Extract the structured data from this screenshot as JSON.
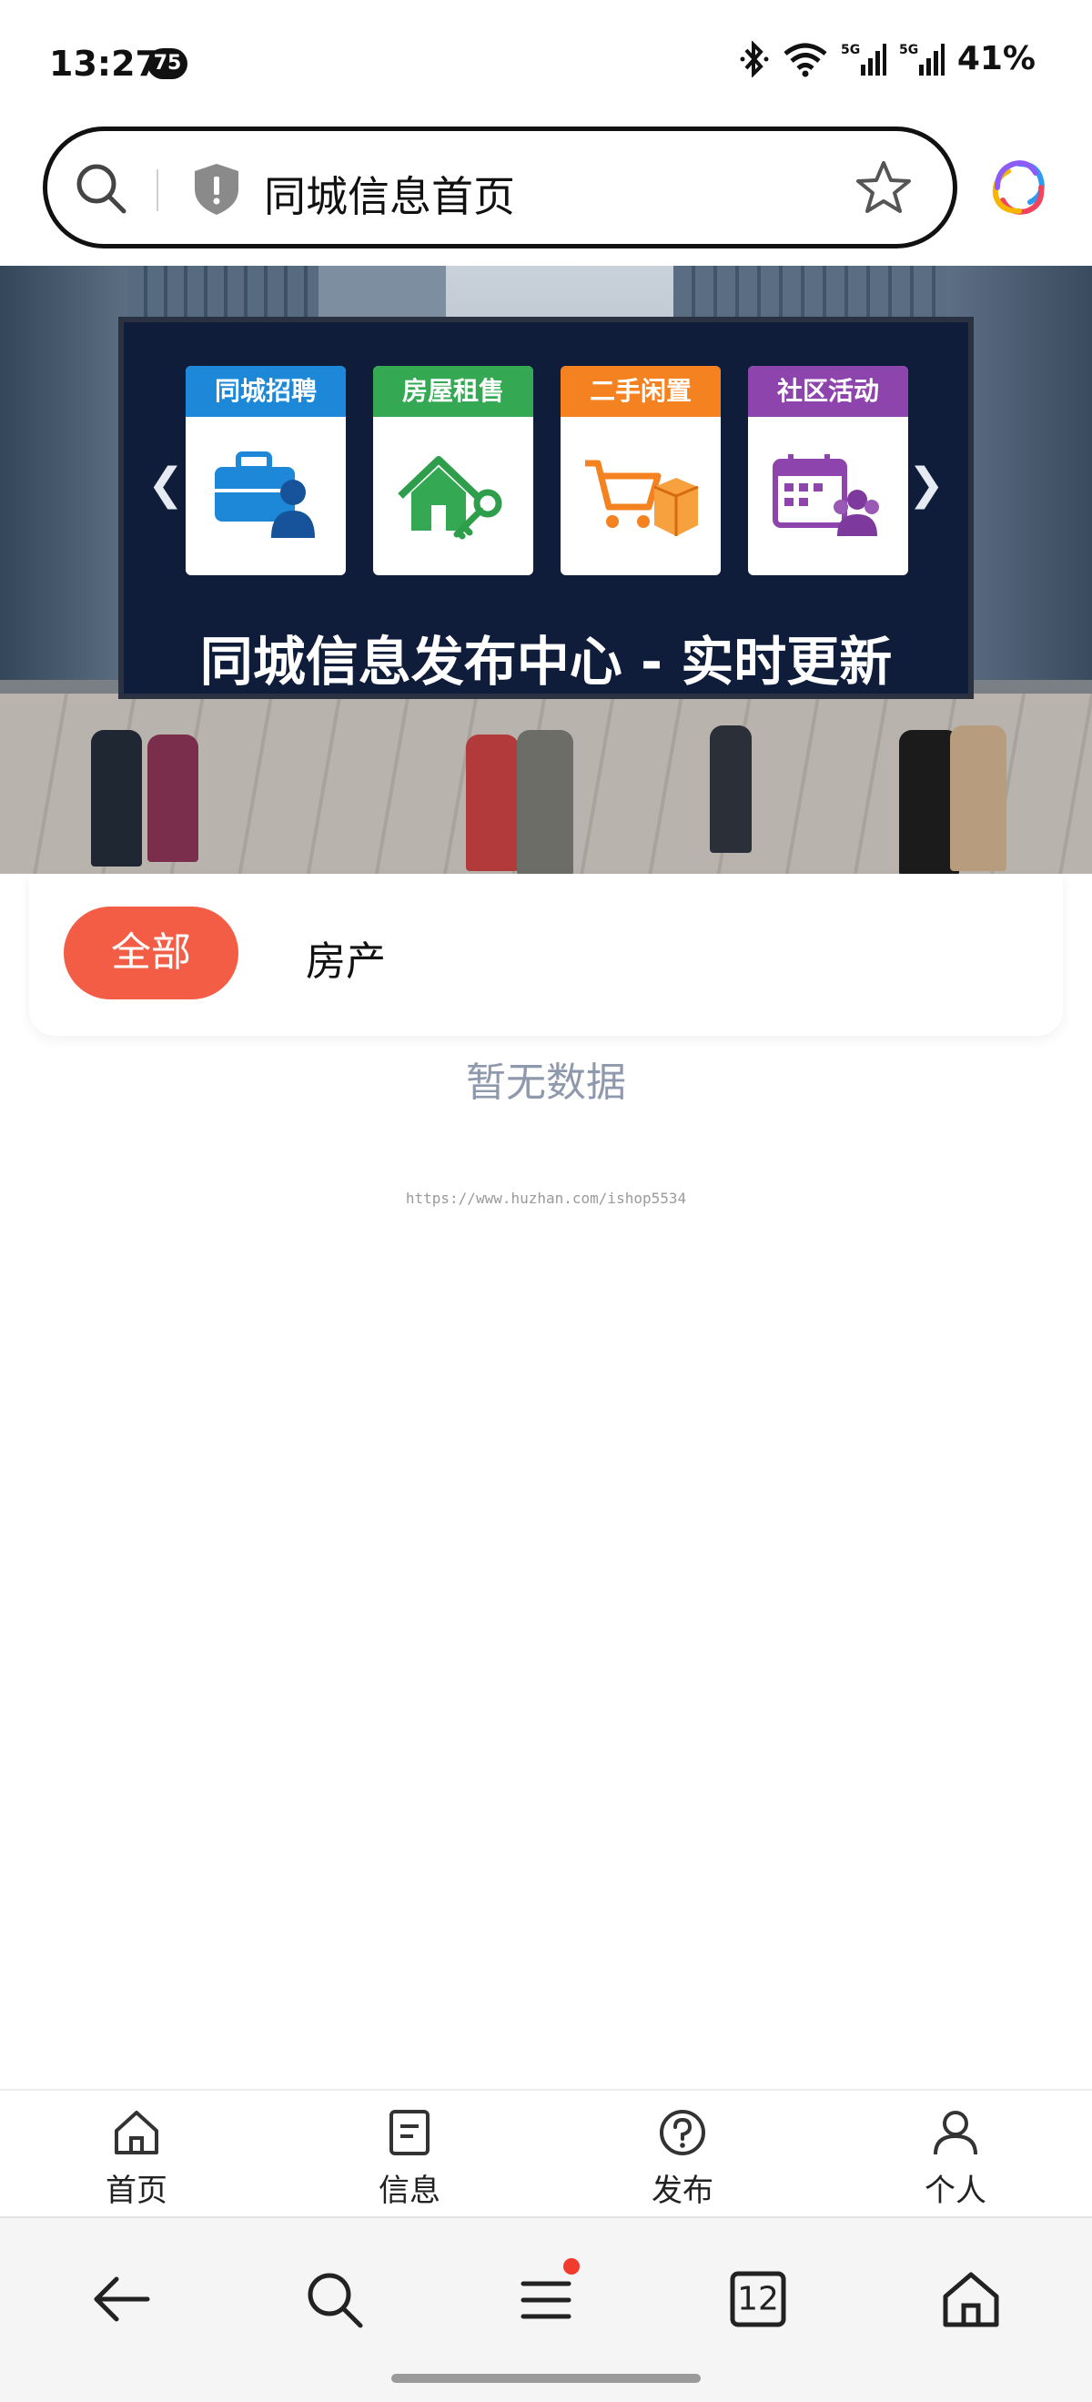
{
  "status_bar": {
    "time": "13:27",
    "notification_count": "75",
    "network_1": "5G",
    "network_2": "5G",
    "battery": "41%"
  },
  "address_bar": {
    "title": "同城信息首页"
  },
  "banner": {
    "tiles": [
      {
        "label": "同城招聘",
        "color": "#1e88d8",
        "icon": "briefcase-person-icon"
      },
      {
        "label": "房屋租售",
        "color": "#34a853",
        "icon": "house-key-icon"
      },
      {
        "label": "二手闲置",
        "color": "#f58220",
        "icon": "cart-box-icon"
      },
      {
        "label": "社区活动",
        "color": "#8e44ad",
        "icon": "calendar-people-icon"
      }
    ],
    "caption": "同城信息发布中心 - 实时更新"
  },
  "filters": {
    "all_label": "全部",
    "house_label": "房产",
    "active_color": "#f45d45"
  },
  "empty_text": "暂无数据",
  "watermark": "https://www.huzhan.com/ishop5534",
  "tab_bar": {
    "items": [
      {
        "label": "首页",
        "icon": "home-icon"
      },
      {
        "label": "信息",
        "icon": "document-icon"
      },
      {
        "label": "发布",
        "icon": "question-circle-icon"
      },
      {
        "label": "个人",
        "icon": "person-icon"
      }
    ]
  },
  "browser_bar": {
    "tabs_count": "12"
  }
}
